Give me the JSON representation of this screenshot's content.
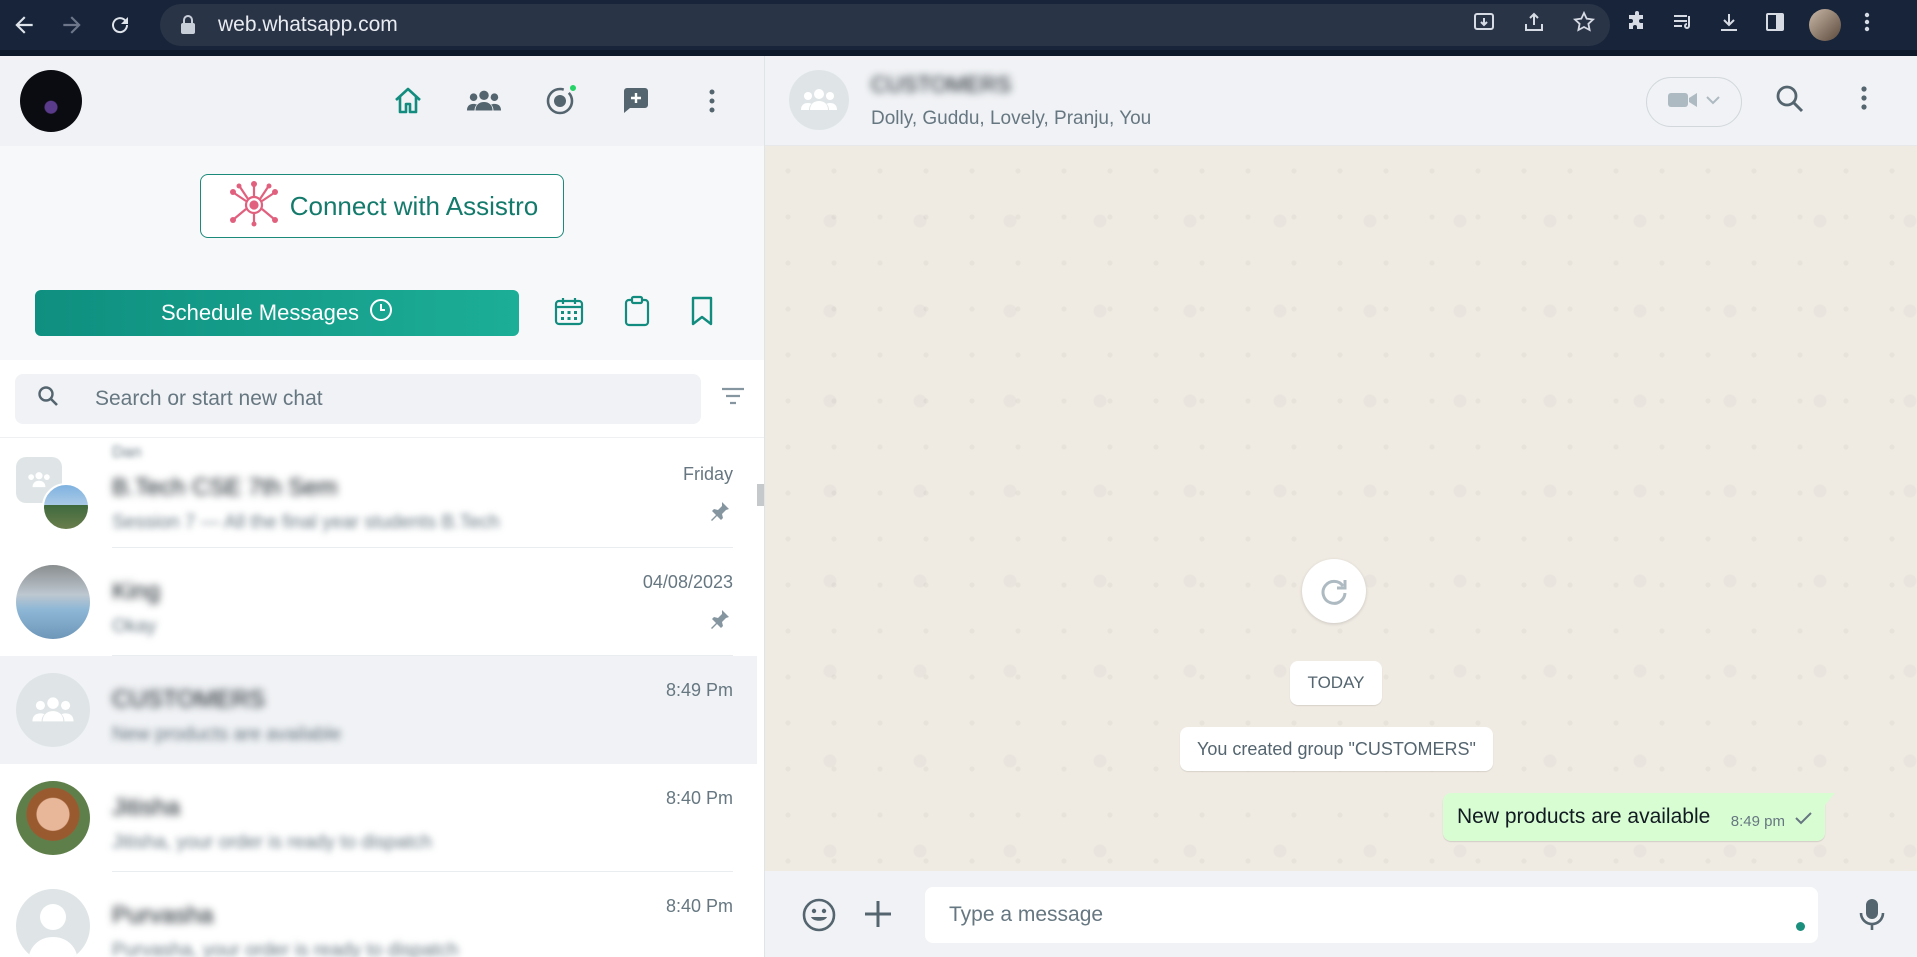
{
  "browser": {
    "url": "web.whatsapp.com"
  },
  "assistro": {
    "connect_label": "Connect with Assistro",
    "schedule_label": "Schedule Messages"
  },
  "search": {
    "placeholder": "Search or start new chat"
  },
  "chats": [
    {
      "name": "B.Tech CSE 7th Sem",
      "sender": "Dan",
      "preview": "Session 7 — All the final year students B.Tech",
      "time": "Friday",
      "pinned": true
    },
    {
      "name": "King",
      "preview": "Okay",
      "time": "04/08/2023",
      "pinned": true
    },
    {
      "name": "CUSTOMERS",
      "preview": "New products are available",
      "time": "8:49 Pm",
      "pinned": false,
      "active": true
    },
    {
      "name": "Jitisha",
      "preview": "Jitisha, your order is ready to dispatch",
      "time": "8:40 Pm",
      "pinned": false
    },
    {
      "name": "Purvasha",
      "preview": "Purvasha, your order is ready to dispatch",
      "time": "8:40 Pm",
      "pinned": false
    }
  ],
  "conversation": {
    "group_name": "CUSTOMERS",
    "members": "Dolly, Guddu, Lovely, Pranju, You",
    "date_divider": "TODAY",
    "system_message": "You created group \"CUSTOMERS\"",
    "outgoing_text": "New products are available",
    "outgoing_time": "8:49 pm",
    "composer_placeholder": "Type a message"
  },
  "colors": {
    "accent": "#128c7e",
    "outgoing_bubble": "#d9fdd3",
    "chat_background": "#efeae2"
  }
}
